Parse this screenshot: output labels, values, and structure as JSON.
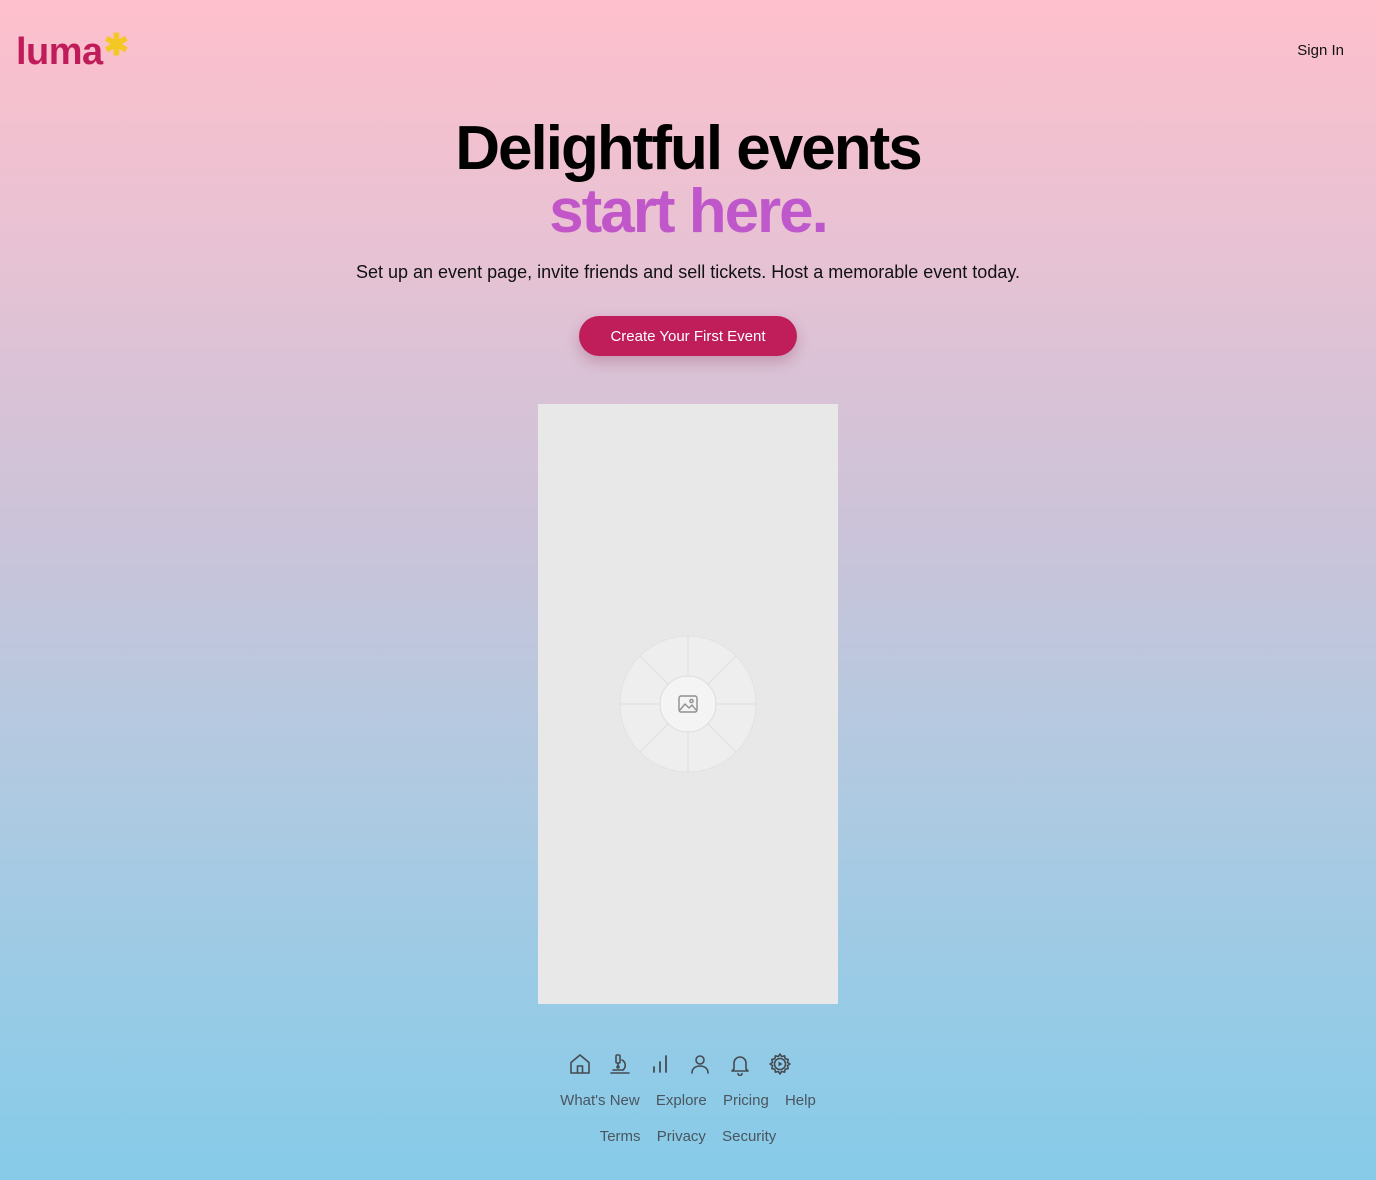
{
  "header": {
    "logo_text": "luma",
    "logo_mark": "✱",
    "sign_in_label": "Sign In"
  },
  "hero": {
    "title_line1": "Delightful events",
    "title_line2": "start here.",
    "subtitle": "Set up an event page, invite friends and sell tickets. Host a memorable event today.",
    "cta_label": "Create Your First Event"
  },
  "preview": {
    "placeholder_icon": "image-icon"
  },
  "footer": {
    "icons": [
      "home-icon",
      "microscope-icon",
      "bar-chart-icon",
      "user-icon",
      "bell-icon",
      "gear-icon"
    ],
    "links_row1": [
      "What's New",
      "Explore",
      "Pricing",
      "Help"
    ],
    "links_row2": [
      "Terms",
      "Privacy",
      "Security"
    ]
  },
  "colors": {
    "brand": "#c01c5a",
    "logo_mark": "#f3c724",
    "cta_bg": "#bf1e5b",
    "accent_gradient_start": "#cb52c0",
    "accent_gradient_end": "#b45cd4"
  }
}
